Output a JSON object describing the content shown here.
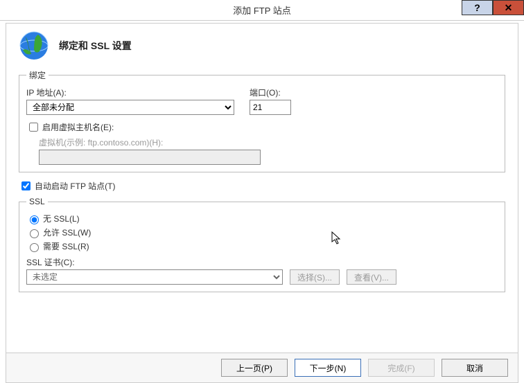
{
  "titlebar": {
    "title": "添加 FTP 站点"
  },
  "header": {
    "title": "绑定和 SSL 设置"
  },
  "binding": {
    "legend": "绑定",
    "ip_label": "IP 地址(A):",
    "ip_value": "全部未分配",
    "port_label": "端口(O):",
    "port_value": "21",
    "vhost_checkbox_label": "启用虚拟主机名(E):",
    "vhost_hint": "虚拟机(示例: ftp.contoso.com)(H):",
    "vhost_value": ""
  },
  "autostart": {
    "label": "自动启动 FTP 站点(T)"
  },
  "ssl": {
    "legend": "SSL",
    "options": [
      {
        "label": "无 SSL(L)",
        "checked": true
      },
      {
        "label": "允许 SSL(W)",
        "checked": false
      },
      {
        "label": "需要 SSL(R)",
        "checked": false
      }
    ],
    "cert_label": "SSL 证书(C):",
    "cert_value": "未选定",
    "select_btn": "选择(S)...",
    "view_btn": "查看(V)..."
  },
  "buttons": {
    "prev": "上一页(P)",
    "next": "下一步(N)",
    "finish": "完成(F)",
    "cancel": "取消"
  }
}
